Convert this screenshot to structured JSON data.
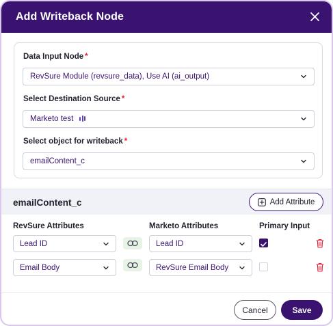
{
  "dialog": {
    "title": "Add Writeback Node",
    "close_icon": "close-icon"
  },
  "form": {
    "data_input": {
      "label": "Data Input Node",
      "required_mark": "*",
      "value": "RevSure Module (revsure_data), Use AI (ai_output)"
    },
    "destination": {
      "label": "Select Destination Source",
      "required_mark": "*",
      "value": "Marketo test",
      "icon": "source-bars-icon"
    },
    "object": {
      "label": "Select object for writeback",
      "required_mark": "*",
      "value": "emailContent_c"
    }
  },
  "mapping": {
    "section_title": "emailContent_c",
    "add_attribute_label": "Add Attribute",
    "headers": {
      "revsure": "RevSure Attributes",
      "marketo": "Marketo Attributes",
      "primary": "Primary Input"
    },
    "rows": [
      {
        "revsure": "Lead ID",
        "marketo": "Lead ID",
        "primary": true
      },
      {
        "revsure": "Email Body",
        "marketo": "RevSure Email Body",
        "primary": false
      }
    ]
  },
  "footer": {
    "cancel_label": "Cancel",
    "save_label": "Save"
  },
  "colors": {
    "brand": "#3a1370",
    "required": "#e0203a",
    "delete": "#e0203a",
    "link_chip": "#e6f3e6"
  }
}
